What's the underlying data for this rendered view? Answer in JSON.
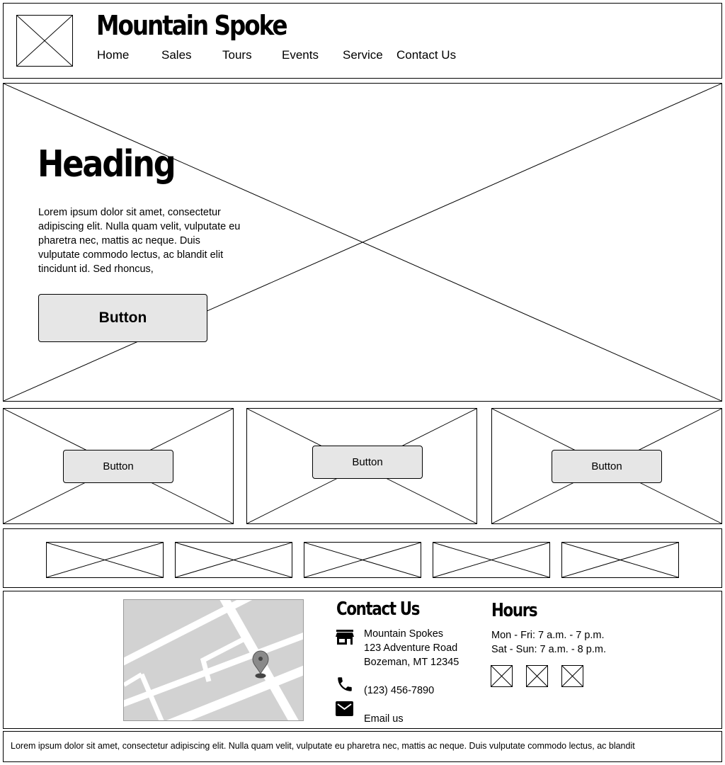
{
  "header": {
    "logo_icon": "image-placeholder-icon",
    "brand": "Mountain Spoke",
    "nav": [
      {
        "label": "Home"
      },
      {
        "label": "Sales"
      },
      {
        "label": "Tours"
      },
      {
        "label": "Events"
      },
      {
        "label": "Service"
      },
      {
        "label": "Contact Us"
      }
    ]
  },
  "hero": {
    "heading": "Heading",
    "body": "Lorem ipsum dolor sit amet, consectetur adipiscing elit. Nulla quam velit, vulputate eu pharetra nec, mattis ac neque. Duis vulputate commodo lectus, ac blandit elit tincidunt id. Sed rhoncus,",
    "button": "Button"
  },
  "cards": [
    {
      "button": "Button"
    },
    {
      "button": "Button"
    },
    {
      "button": "Button"
    }
  ],
  "gallery": {
    "count": 5
  },
  "contact": {
    "title": "Contact Us",
    "address_lines": [
      "Mountain Spokes",
      "123 Adventure Road",
      "Bozeman, MT 12345"
    ],
    "phone": "(123) 456-7890",
    "email": "Email us",
    "icons": {
      "store": "store-icon",
      "phone": "phone-icon",
      "email": "mail-icon",
      "map_pin": "map-pin-icon"
    }
  },
  "hours": {
    "title": "Hours",
    "lines": [
      "Mon - Fri: 7 a.m. - 7 p.m.",
      "Sat - Sun: 7 a.m. - 8 p.m."
    ],
    "social_icons": [
      "social-icon-1",
      "social-icon-2",
      "social-icon-3"
    ]
  },
  "footer": {
    "text": "Lorem ipsum dolor sit amet, consectetur adipiscing elit. Nulla quam velit, vulputate eu pharetra nec, mattis ac neque. Duis vulputate commodo lectus, ac blandit"
  },
  "colors": {
    "button_bg": "#e6e6e6",
    "map_bg": "#d2d2d2",
    "border": "#000000"
  }
}
